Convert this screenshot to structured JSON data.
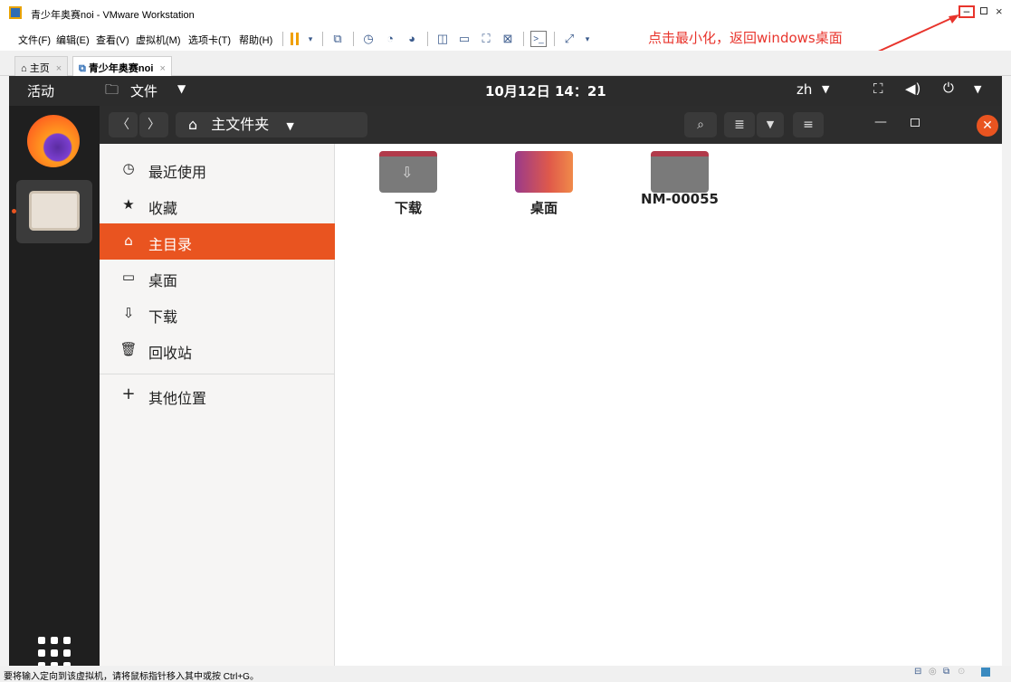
{
  "window": {
    "title": "青少年奥赛noi - VMware Workstation",
    "min_label": "–",
    "max_label": "▫",
    "close_label": "×"
  },
  "menu": {
    "items": [
      "文件(F)",
      "编辑(E)",
      "查看(V)",
      "虚拟机(M)",
      "选项卡(T)",
      "帮助(H)"
    ]
  },
  "annotation": {
    "text": "点击最小化，返回windows桌面",
    "color": "#e8342c"
  },
  "tabs": [
    {
      "label": "主页"
    },
    {
      "label": "青少年奥赛noi"
    }
  ],
  "ubuntu": {
    "activities": "活动",
    "app_menu": "文件",
    "clock": "10月12日  14：21",
    "lang": "zh",
    "location": "主文件夹"
  },
  "sidebar": {
    "items": [
      {
        "label": "最近使用",
        "icon": "clock-icon"
      },
      {
        "label": "收藏",
        "icon": "star-icon"
      },
      {
        "label": "主目录",
        "icon": "home-icon",
        "active": true
      },
      {
        "label": "桌面",
        "icon": "desktop-icon"
      },
      {
        "label": "下载",
        "icon": "download-icon"
      },
      {
        "label": "回收站",
        "icon": "trash-icon"
      }
    ],
    "other": "其他位置"
  },
  "files": [
    {
      "name": "下载"
    },
    {
      "name": "桌面"
    },
    {
      "name": "NM-00055"
    }
  ],
  "statusbar": {
    "text": "要将输入定向到该虚拟机，请将鼠标指针移入其中或按 Ctrl+G。"
  },
  "colors": {
    "accent": "#e95420",
    "annotation": "#e8342c"
  }
}
